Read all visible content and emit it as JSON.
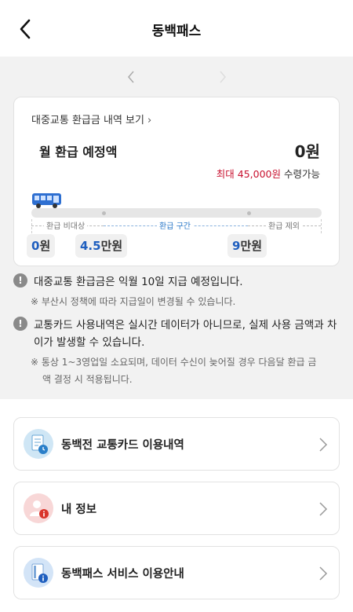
{
  "header": {
    "title": "동백패스"
  },
  "card": {
    "history_link": "대중교통 환급금 내역 보기",
    "refund_label": "월 환급 예정액",
    "refund_value": "0원",
    "max_prefix": "최대",
    "max_amount": "45,000원",
    "max_suffix": "수령가능",
    "progress_value": 0,
    "zones": {
      "left": "환급 비대상",
      "middle": "환급 구간",
      "right": "환급 제외"
    },
    "markers": [
      {
        "num": "0",
        "unit": "원"
      },
      {
        "num": "4.5",
        "unit": "만원"
      },
      {
        "num": "9",
        "unit": "만원"
      }
    ]
  },
  "notices": [
    {
      "main": "대중교통 환급금은 익월 10일 지급 예정입니다.",
      "sub": "※ 부산시 정책에 따라 지급일이 변경될 수 있습니다."
    },
    {
      "main_line1": "교통카드 사용내역은 실시간 데이터가 아니므로, 실제 사용 금액과 차",
      "main_line2": "이가 발생할 수 있습니다.",
      "sub_line1": "※ 통상 1~3영업일 소요되며,  데이터 수신이 늦어질 경우 다음달 환급 금",
      "sub_line2": "액 결정 시 적용됩니다."
    }
  ],
  "menu": [
    {
      "label": "동백전 교통카드 이용내역",
      "icon": "card-history-icon"
    },
    {
      "label": "내 정보",
      "icon": "user-info-icon"
    },
    {
      "label": "동백패스 서비스 이용안내",
      "icon": "service-guide-icon"
    }
  ],
  "colors": {
    "accent_red": "#c8102e",
    "accent_blue": "#1f5fbf",
    "zone_blue": "#2b78c8"
  }
}
